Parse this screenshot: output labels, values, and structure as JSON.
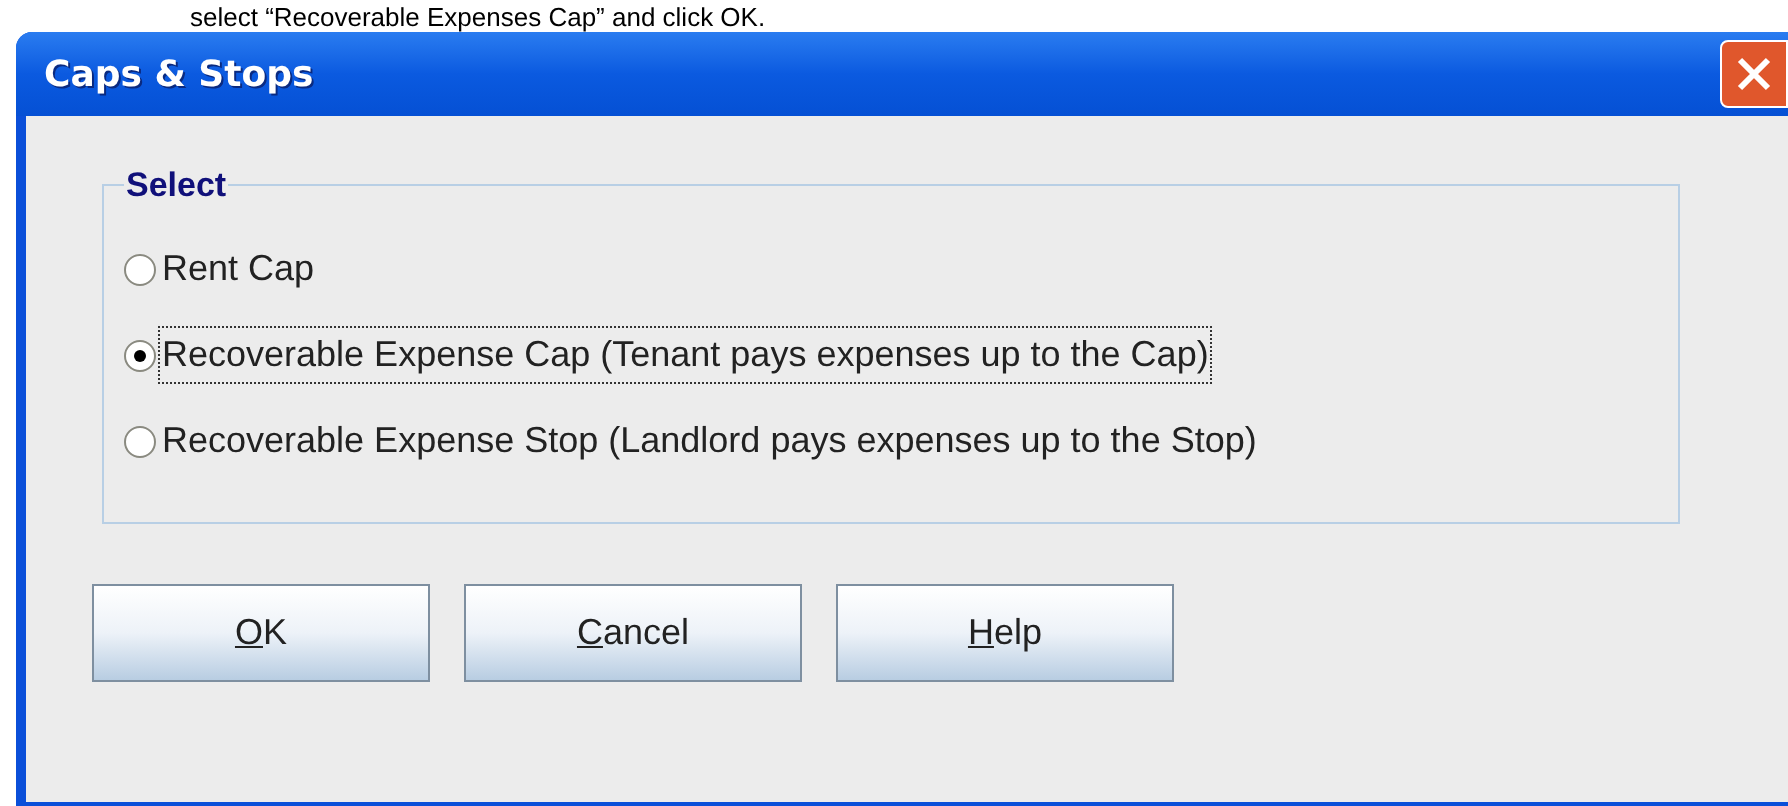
{
  "instruction": "select “Recoverable Expenses Cap” and click OK.",
  "window": {
    "title": "Caps & Stops"
  },
  "group": {
    "legend": "Select",
    "options": [
      {
        "label": "Rent Cap",
        "selected": false,
        "focused": false
      },
      {
        "label": "Recoverable Expense Cap (Tenant pays expenses up to the Cap)",
        "selected": true,
        "focused": true
      },
      {
        "label": "Recoverable Expense Stop (Landlord pays expenses up to the Stop)",
        "selected": false,
        "focused": false
      }
    ]
  },
  "buttons": [
    {
      "mnemonic": "O",
      "rest": "K"
    },
    {
      "mnemonic": "C",
      "rest": "ancel"
    },
    {
      "mnemonic": "H",
      "rest": "elp"
    }
  ]
}
